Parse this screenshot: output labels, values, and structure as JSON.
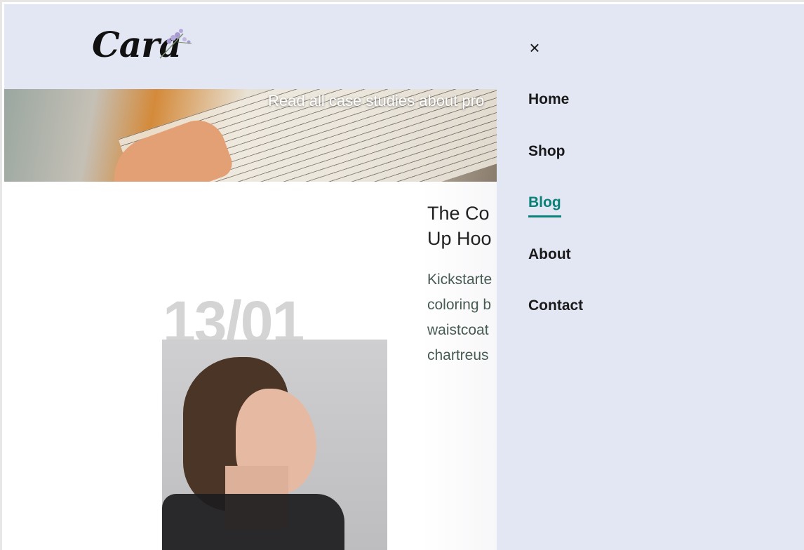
{
  "brand": {
    "logo_text": "Cara"
  },
  "hero": {
    "text": "Read all case studies about pro"
  },
  "post": {
    "date": "13/01",
    "title": "The Co\nUp Hoo",
    "excerpt": "Kickstarte\ncoloring b\nwaistcoat\nchartreus"
  },
  "drawer": {
    "close_icon": "×",
    "nav": [
      {
        "label": "Home",
        "active": false
      },
      {
        "label": "Shop",
        "active": false
      },
      {
        "label": "Blog",
        "active": true
      },
      {
        "label": "About",
        "active": false
      },
      {
        "label": "Contact",
        "active": false
      }
    ]
  },
  "colors": {
    "accent": "#088178",
    "header_bg": "#e3e6f3",
    "drawer_bg": "#e3e6f3",
    "text_dark": "#1a1a1a"
  }
}
